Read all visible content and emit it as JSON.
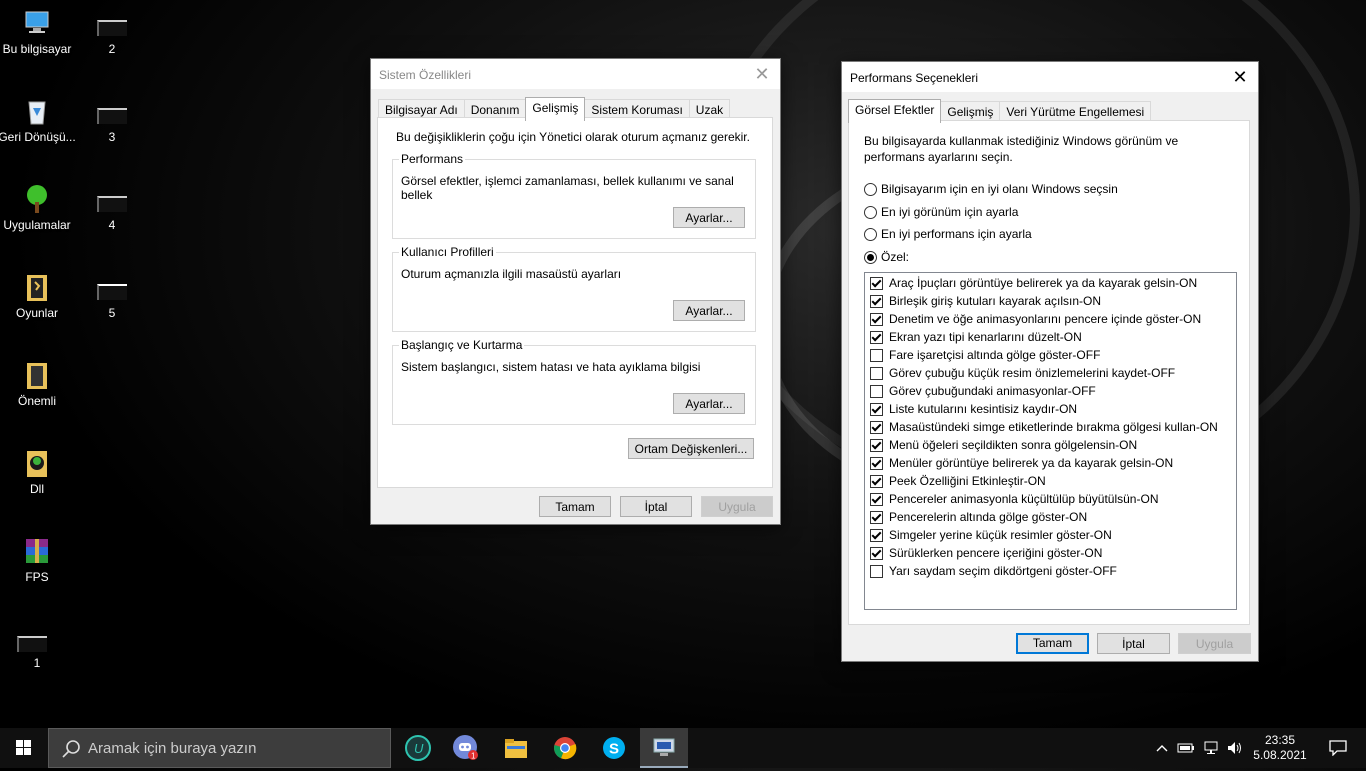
{
  "desktop": {
    "icons": [
      {
        "label": "Bu bilgisayar"
      },
      {
        "label": "Geri Dönüşü..."
      },
      {
        "label": "Uygulamalar"
      },
      {
        "label": "Oyunlar"
      },
      {
        "label": "Önemli"
      },
      {
        "label": "Dll"
      },
      {
        "label": "FPS"
      },
      {
        "label": "1"
      }
    ],
    "mini_icons": [
      {
        "label": "2"
      },
      {
        "label": "3"
      },
      {
        "label": "4"
      },
      {
        "label": "5"
      }
    ]
  },
  "sistem": {
    "title": "Sistem Özellikleri",
    "tabs": [
      "Bilgisayar Adı",
      "Donanım",
      "Gelişmiş",
      "Sistem Koruması",
      "Uzak"
    ],
    "active_tab": "Gelişmiş",
    "admin_note": "Bu değişikliklerin çoğu için Yönetici olarak oturum açmanız gerekir.",
    "performance": {
      "label": "Performans",
      "text": "Görsel efektler, işlemci zamanlaması, bellek kullanımı ve sanal bellek",
      "button": "Ayarlar..."
    },
    "profiles": {
      "label": "Kullanıcı Profilleri",
      "text": "Oturum açmanızla ilgili masaüstü ayarları",
      "button": "Ayarlar..."
    },
    "startup": {
      "label": "Başlangıç ve Kurtarma",
      "text": "Sistem başlangıcı, sistem hatası ve hata ayıklama bilgisi",
      "button": "Ayarlar..."
    },
    "env_button": "Ortam Değişkenleri...",
    "ok": "Tamam",
    "cancel": "İptal",
    "apply": "Uygula"
  },
  "perf": {
    "title": "Performans Seçenekleri",
    "tabs": [
      "Görsel Efektler",
      "Gelişmiş",
      "Veri Yürütme Engellemesi"
    ],
    "active_tab": "Görsel Efektler",
    "intro": "Bu bilgisayarda kullanmak istediğiniz Windows görünüm ve performans ayarlarını seçin.",
    "radios": [
      {
        "label": "Bilgisayarım için en iyi olanı Windows seçsin",
        "checked": false
      },
      {
        "label": "En iyi görünüm için ayarla",
        "checked": false
      },
      {
        "label": "En iyi performans için ayarla",
        "checked": false
      },
      {
        "label": "Özel:",
        "checked": true
      }
    ],
    "options": [
      {
        "label": "Araç İpuçları görüntüye belirerek ya da kayarak gelsin-ON",
        "checked": true
      },
      {
        "label": "Birleşik giriş kutuları kayarak açılsın-ON",
        "checked": true
      },
      {
        "label": "Denetim ve öğe animasyonlarını pencere içinde göster-ON",
        "checked": true
      },
      {
        "label": "Ekran yazı tipi kenarlarını düzelt-ON",
        "checked": true
      },
      {
        "label": "Fare işaretçisi altında gölge göster-OFF",
        "checked": false
      },
      {
        "label": "Görev çubuğu küçük resim önizlemelerini kaydet-OFF",
        "checked": false
      },
      {
        "label": "Görev çubuğundaki animasyonlar-OFF",
        "checked": false
      },
      {
        "label": "Liste kutularını kesintisiz kaydır-ON",
        "checked": true
      },
      {
        "label": "Masaüstündeki simge etiketlerinde bırakma gölgesi kullan-ON",
        "checked": true
      },
      {
        "label": "Menü öğeleri seçildikten sonra gölgelensin-ON",
        "checked": true
      },
      {
        "label": "Menüler görüntüye belirerek ya da kayarak gelsin-ON",
        "checked": true
      },
      {
        "label": "Peek Özelliğini Etkinleştir-ON",
        "checked": true
      },
      {
        "label": "Pencereler animasyonla küçültülüp büyütülsün-ON",
        "checked": true
      },
      {
        "label": "Pencerelerin altında gölge göster-ON",
        "checked": true
      },
      {
        "label": "Simgeler yerine küçük resimler göster-ON",
        "checked": true
      },
      {
        "label": "Sürüklerken pencere içeriğini göster-ON",
        "checked": true
      },
      {
        "label": "Yarı saydam seçim dikdörtgeni göster-OFF",
        "checked": false
      }
    ],
    "ok": "Tamam",
    "cancel": "İptal",
    "apply": "Uygula"
  },
  "taskbar": {
    "search_placeholder": "Aramak için buraya yazın",
    "time": "23:35",
    "date": "5.08.2021",
    "discord_badge": "1"
  },
  "colors": {
    "accent": "#0078d7",
    "taskbar": "#101010"
  }
}
